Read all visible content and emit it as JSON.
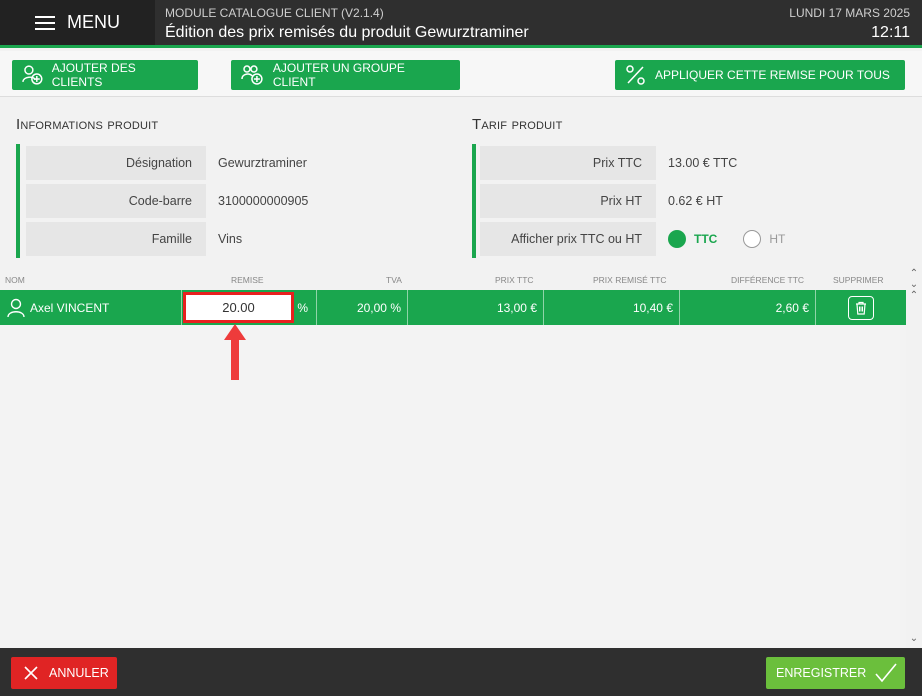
{
  "header": {
    "menu_label": "MENU",
    "module": "MODULE CATALOGUE CLIENT (V2.1.4)",
    "title": "Édition des prix remisés du produit Gewurztraminer",
    "date": "LUNDI 17 MARS 2025",
    "time": "12:11"
  },
  "toolbar": {
    "add_clients": "AJOUTER DES CLIENTS",
    "add_group": "AJOUTER UN GROUPE CLIENT",
    "apply_all": "APPLIQUER CETTE REMISE POUR TOUS"
  },
  "product_info": {
    "heading": "Informations produit",
    "rows": [
      {
        "label": "Désignation",
        "value": "Gewurztraminer"
      },
      {
        "label": "Code-barre",
        "value": "3100000000905"
      },
      {
        "label": "Famille",
        "value": "Vins"
      }
    ]
  },
  "tarif": {
    "heading": "Tarif produit",
    "rows": [
      {
        "label": "Prix TTC",
        "value": "13.00 € TTC"
      },
      {
        "label": "Prix HT",
        "value": "0.62 € HT"
      }
    ],
    "display_label": "Afficher prix TTC ou HT",
    "options": [
      "TTC",
      "HT"
    ],
    "selected": "TTC"
  },
  "table": {
    "headers": {
      "nom": "NOM",
      "remise": "REMISE",
      "tva": "TVA",
      "prix_ttc": "PRIX TTC",
      "prix_remise": "PRIX REMISÉ TTC",
      "difference": "DIFFÉRENCE TTC",
      "supprimer": "SUPPRIMER"
    },
    "rows": [
      {
        "nom": "Axel VINCENT",
        "remise": "20.00",
        "remise_unit": "%",
        "tva": "20,00 %",
        "prix_ttc": "13,00 €",
        "prix_remise": "10,40 €",
        "difference": "2,60 €"
      }
    ]
  },
  "footer": {
    "cancel": "ANNULER",
    "save": "ENREGISTRER"
  },
  "colors": {
    "accent": "#1aa64e",
    "danger": "#e02424",
    "save": "#6bbf3c",
    "header_bg": "#2f2f2f",
    "highlight": "#e8201f"
  }
}
